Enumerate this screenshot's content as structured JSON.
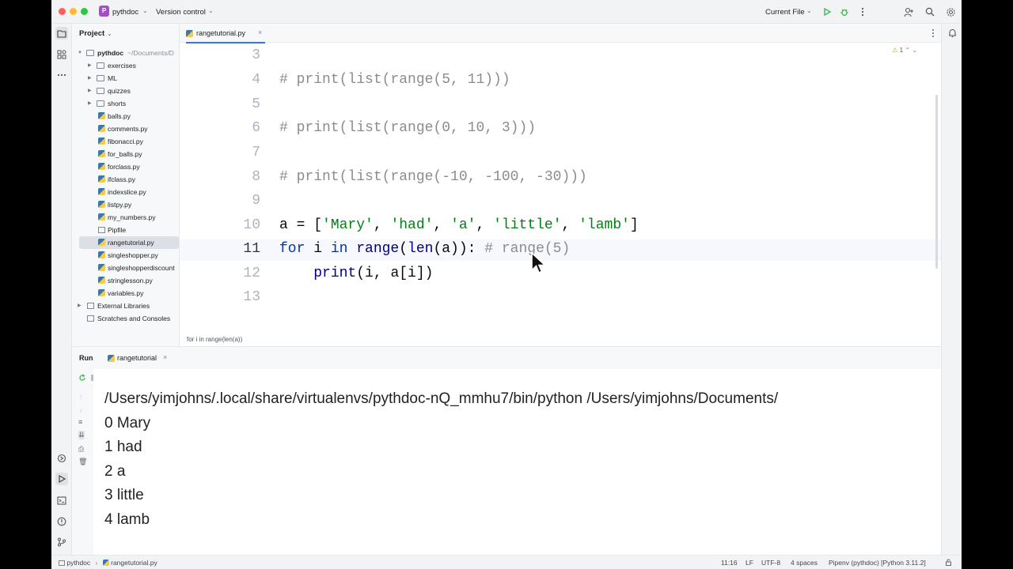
{
  "titlebar": {
    "project_badge": "P",
    "project_name": "pythdoc",
    "version_control": "Version control",
    "run_config": "Current File"
  },
  "project_panel": {
    "header": "Project",
    "root_name": "pythdoc",
    "root_path": "~/Documents/D",
    "folders": [
      "exercises",
      "ML",
      "quizzes",
      "shorts"
    ],
    "files": [
      "balls.py",
      "comments.py",
      "fibonacci.py",
      "for_balls.py",
      "forclass.py",
      "ifclass.py",
      "indexslice.py",
      "listpy.py",
      "my_numbers.py",
      "Pipfile",
      "rangetutorial.py",
      "singleshopper.py",
      "singleshopperdiscount",
      "stringlesson.py",
      "variables.py"
    ],
    "external_libraries": "External Libraries",
    "scratches": "Scratches and Consoles"
  },
  "editor": {
    "tab_label": "rangetutorial.py",
    "tab_close": "×",
    "warning_count": "1",
    "line_numbers": [
      "3",
      "4",
      "5",
      "6",
      "7",
      "8",
      "9",
      "10",
      "11",
      "12",
      "13"
    ],
    "code": {
      "line4": "# print(list(range(5, 11)))",
      "line6": "# print(list(range(0, 10, 3)))",
      "line8": "# print(list(range(-10, -100, -30)))",
      "line10_var": "a",
      "line10_eq": " = [",
      "line10_s1": "'Mary'",
      "line10_s2": "'had'",
      "line10_s3": "'a'",
      "line10_s4": "'little'",
      "line10_s5": "'lamb'",
      "line10_comma": ", ",
      "line10_close": "]",
      "line11_for": "for",
      "line11_i": " i ",
      "line11_in": "in",
      "line11_range": " range",
      "line11_paren": "(",
      "line11_len": "len",
      "line11_args": "(a)):",
      "line11_comment": " # range(5)",
      "line12_indent": "    ",
      "line12_print": "print",
      "line12_args": "(i, a[i])"
    },
    "breadcrumb": "for i in range(len(a))"
  },
  "run_panel": {
    "title": "Run",
    "tab_label": "rangetutorial",
    "tab_close": "×",
    "output": [
      "/Users/yimjohns/.local/share/virtualenvs/pythdoc-nQ_mmhu7/bin/python /Users/yimjohns/Documents/",
      "0 Mary",
      "1 had",
      "2 a",
      "3 little",
      "4 lamb"
    ]
  },
  "statusbar": {
    "crumb_project": "pythdoc",
    "crumb_sep": "›",
    "crumb_file": "rangetutorial.py",
    "position": "11:16",
    "line_ending": "LF",
    "encoding": "UTF-8",
    "indent": "4 spaces",
    "interpreter": "Pipenv (pythdoc) [Python 3.11.2]"
  },
  "colors": {
    "accent": "#3574f0",
    "project_badge": "#a24fc8",
    "run_green": "#3fb950"
  }
}
